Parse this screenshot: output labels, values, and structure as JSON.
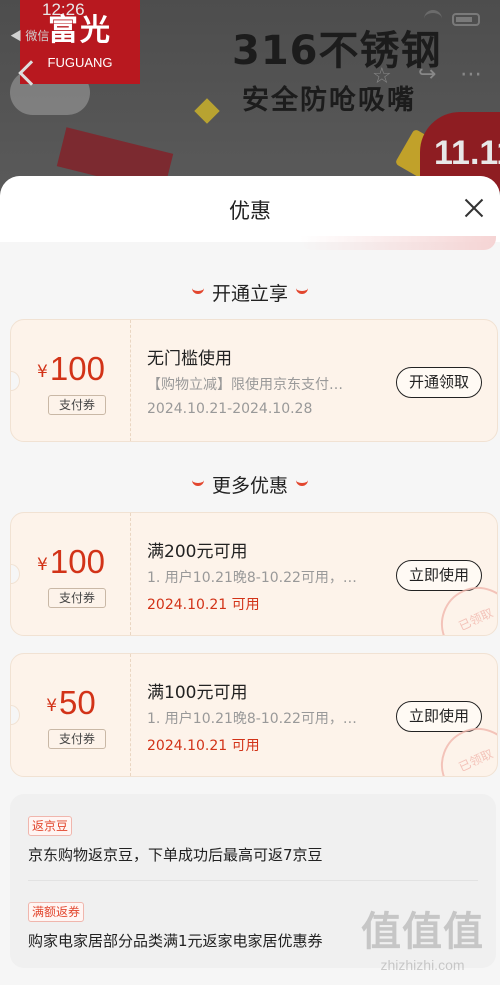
{
  "status_bar": {
    "time": "12:26",
    "back_app": "◀ 微信"
  },
  "banner": {
    "logo_cn": "富光",
    "logo_en": "FUGUANG",
    "headline": "316不锈钢",
    "subline": "安全防呛吸嘴",
    "badge": "11.11"
  },
  "sheet": {
    "title": "优惠"
  },
  "sections": [
    {
      "title": "开通立享"
    },
    {
      "title": "更多优惠"
    }
  ],
  "coupons": [
    {
      "currency": "¥",
      "amount": "100",
      "type": "支付券",
      "title": "无门槛使用",
      "desc": "【购物立减】限使用京东支付…",
      "date": "2024.10.21-2024.10.28",
      "button": "开通领取"
    },
    {
      "currency": "¥",
      "amount": "100",
      "type": "支付券",
      "title": "满200元可用",
      "desc": "1. 用户10.21晚8-10.22可用，…",
      "date": "2024.10.21 可用",
      "button": "立即使用",
      "stamp": "已领取"
    },
    {
      "currency": "¥",
      "amount": "50",
      "type": "支付券",
      "title": "满100元可用",
      "desc": "1. 用户10.21晚8-10.22可用，…",
      "date": "2024.10.21 可用",
      "button": "立即使用",
      "stamp": "已领取"
    }
  ],
  "info": [
    {
      "tag": "返京豆",
      "text": "京东购物返京豆，下单成功后最高可返7京豆"
    },
    {
      "tag": "满额返券",
      "text": "购家电家居部分品类满1元返家电家居优惠券"
    }
  ],
  "watermark": {
    "cn": "值值值",
    "en": "zhizhizhi.com"
  },
  "colors": {
    "accent_red": "#d23318",
    "coupon_bg": "#fdf3ea",
    "sheet_bg": "#f6f6f6"
  }
}
